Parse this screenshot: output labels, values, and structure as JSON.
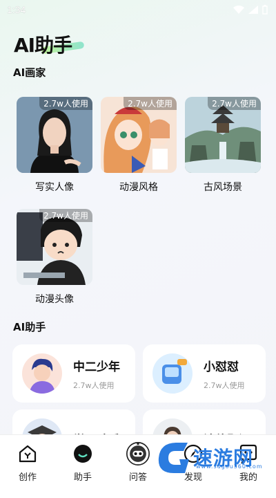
{
  "status_bar": {
    "time": "1:34"
  },
  "header": {
    "title": "AI助手"
  },
  "sections": {
    "painter_title": "AI画家",
    "assistant_title": "AI助手"
  },
  "painters": [
    {
      "name": "写实人像",
      "usage": "2.7w人使用",
      "icon": "realistic-portrait"
    },
    {
      "name": "动漫风格",
      "usage": "2.7w人使用",
      "icon": "anime-style"
    },
    {
      "name": "古风场景",
      "usage": "2.7w人使用",
      "icon": "ancient-scene"
    },
    {
      "name": "动漫头像",
      "usage": "2.7w人使用",
      "icon": "anime-avatar"
    }
  ],
  "assistants": [
    {
      "name": "中二少年",
      "usage": "2.7w人使用"
    },
    {
      "name": "小怼怼",
      "usage": "2.7w人使用"
    },
    {
      "name": "学习助手",
      "usage": ""
    },
    {
      "name": "法律顾问",
      "usage": ""
    }
  ],
  "nav": [
    {
      "label": "创作",
      "icon": "home-icon"
    },
    {
      "label": "助手",
      "icon": "assistant-icon"
    },
    {
      "label": "问答",
      "icon": "robot-icon"
    },
    {
      "label": "发现",
      "icon": "compass-icon"
    },
    {
      "label": "我的",
      "icon": "chat-face-icon"
    }
  ],
  "watermark": {
    "text": "速游网",
    "url": "www.sugou360.com"
  },
  "colors": {
    "accent": "#2b7ce0",
    "title_highlight": "#b8f28a"
  }
}
